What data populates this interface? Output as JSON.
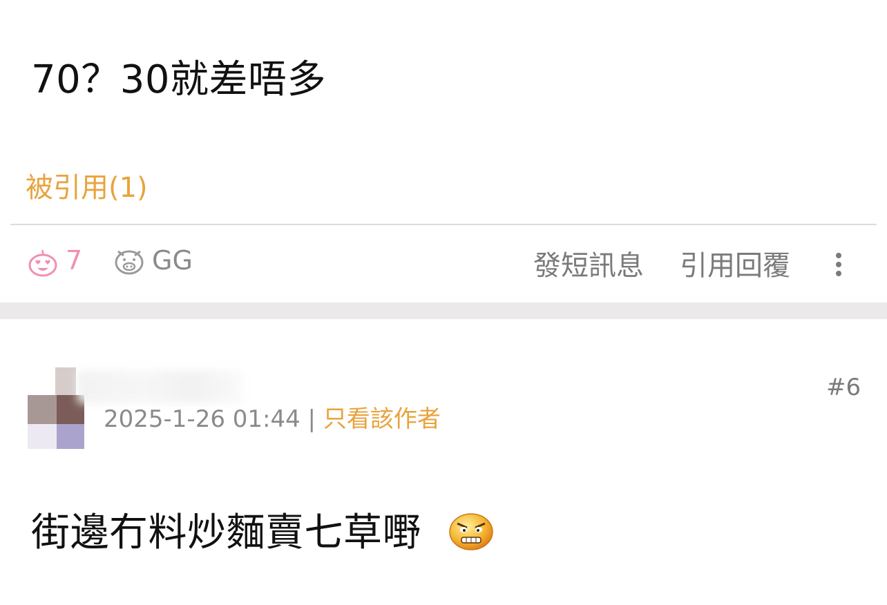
{
  "posts": [
    {
      "body": "70？30就差唔多",
      "quoted_label": "被引用(1)",
      "like_count": "7",
      "dislike_label": "GG",
      "actions": {
        "pm": "發短訊息",
        "quote_reply": "引用回覆"
      }
    },
    {
      "floor": "#6",
      "timestamp": "2025-1-26 01:44",
      "separator": " | ",
      "only_author_label": "只看該作者",
      "body": "街邊冇料炒麵賣七草嘢"
    }
  ],
  "colors": {
    "accent_orange": "#e8a33d",
    "like_pink": "#f08fb5",
    "muted_gray": "#8a8a8a",
    "separator_band": "#ebe9ea"
  },
  "icons": [
    "heart-eyes-emoji-icon",
    "pig-face-icon",
    "more-vertical-icon",
    "angry-smiley-emoji-icon"
  ]
}
